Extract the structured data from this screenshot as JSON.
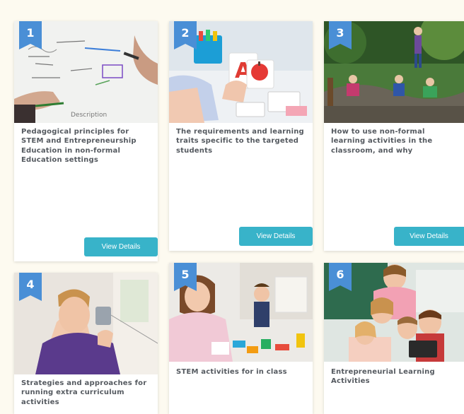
{
  "cards": [
    {
      "number": "1",
      "title": "Pedagogical principles for STEM and Entrepreneurship Education in non-formal Education settings",
      "button": "View Details"
    },
    {
      "number": "2",
      "title": "The requirements and learning traits specific to the targeted students",
      "button": "View Details"
    },
    {
      "number": "3",
      "title": "How to use non-formal learning activities in the classroom, and why",
      "button": "View Details"
    },
    {
      "number": "4",
      "title": "Strategies and approaches for running extra curriculum activities"
    },
    {
      "number": "5",
      "title": "STEM activities for in class"
    },
    {
      "number": "6",
      "title": "Entrepreneurial Learning Activities"
    }
  ],
  "colors": {
    "badge": "#4a8fd6",
    "button": "#38b3c9",
    "page": "#fdfaf0"
  }
}
